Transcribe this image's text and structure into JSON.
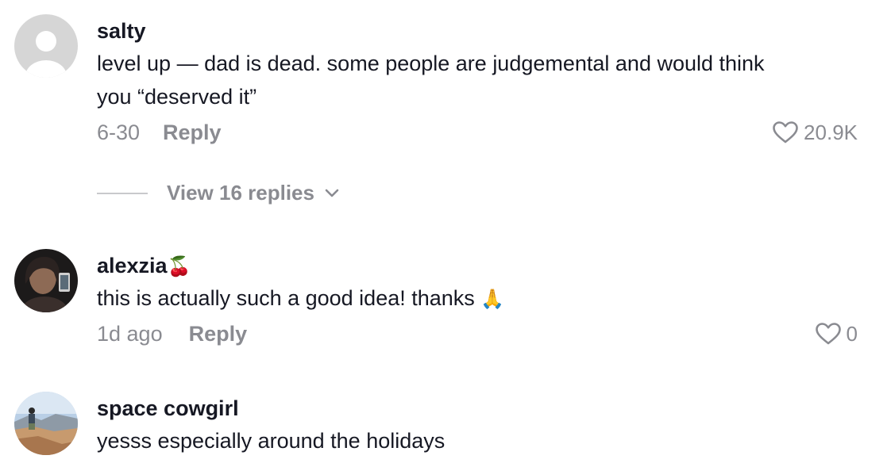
{
  "comments": [
    {
      "username": "salty",
      "text_line1": "level up — dad is dead. some people are judgemental and would think",
      "text_line2": "you “deserved it”",
      "date": "6-30",
      "reply_label": "Reply",
      "likes": "20.9K",
      "view_replies": "View 16 replies"
    },
    {
      "username": "alexzia",
      "username_emoji": "🍒",
      "text": "this is actually such a good idea! thanks",
      "text_emoji": "🙏",
      "date": "1d ago",
      "reply_label": "Reply",
      "likes": "0"
    },
    {
      "username": "space cowgirl",
      "text": "yesss especially around the holidays"
    }
  ],
  "colors": {
    "text_primary": "#161823",
    "text_secondary": "#8a8b91",
    "avatar_placeholder": "#d6d6d6"
  }
}
